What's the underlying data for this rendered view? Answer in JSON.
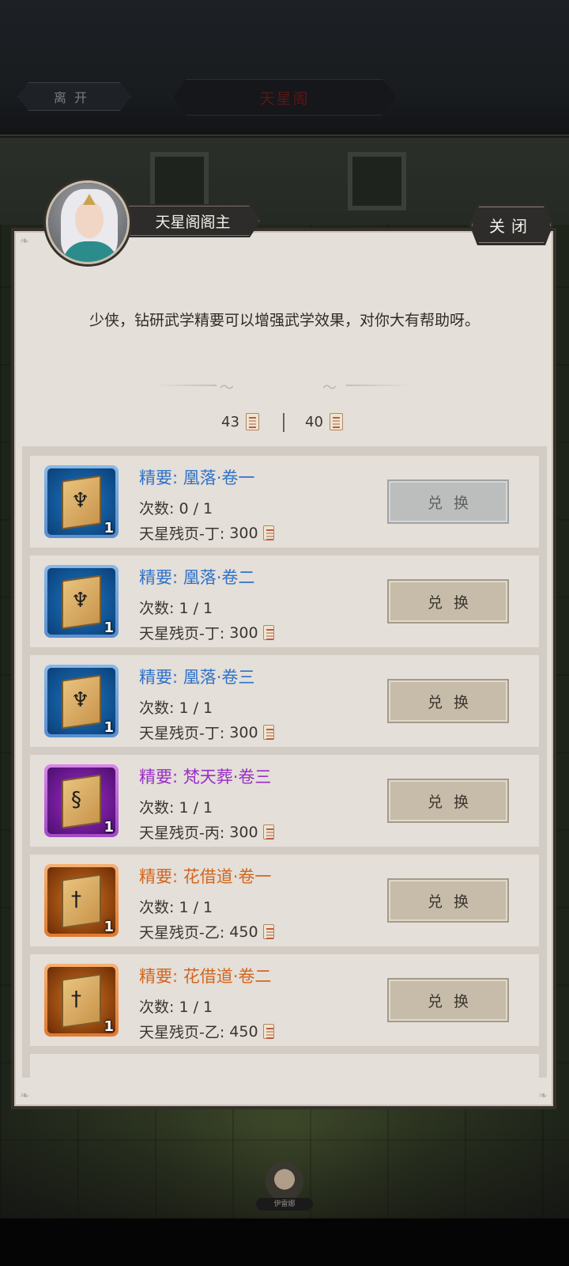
{
  "header": {
    "leave_label": "离开",
    "title": "天星阁"
  },
  "npc": {
    "name": "天星阁阁主",
    "dialog": "少侠，钻研武学精要可以增强武学效果，对你大有帮助呀。"
  },
  "close_label": "关闭",
  "currencies": [
    {
      "amount": "43",
      "icon": "scroll-page-icon"
    },
    {
      "amount": "40",
      "icon": "scroll-page-icon"
    }
  ],
  "items": [
    {
      "name": "精要: 凰落·卷一",
      "quality": "blue",
      "qty": "1",
      "count_label": "次数:",
      "count": "0 / 1",
      "cost_label": "天星残页-丁:",
      "cost": "300",
      "button": "兑换",
      "enabled": false
    },
    {
      "name": "精要: 凰落·卷二",
      "quality": "blue",
      "qty": "1",
      "count_label": "次数:",
      "count": "1 / 1",
      "cost_label": "天星残页-丁:",
      "cost": "300",
      "button": "兑换",
      "enabled": true
    },
    {
      "name": "精要: 凰落·卷三",
      "quality": "blue",
      "qty": "1",
      "count_label": "次数:",
      "count": "1 / 1",
      "cost_label": "天星残页-丁:",
      "cost": "300",
      "button": "兑换",
      "enabled": true
    },
    {
      "name": "精要: 梵天葬·卷三",
      "quality": "purple",
      "qty": "1",
      "count_label": "次数:",
      "count": "1 / 1",
      "cost_label": "天星残页-丙:",
      "cost": "300",
      "button": "兑换",
      "enabled": true
    },
    {
      "name": "精要: 花借道·卷一",
      "quality": "orange",
      "qty": "1",
      "count_label": "次数:",
      "count": "1 / 1",
      "cost_label": "天星残页-乙:",
      "cost": "450",
      "button": "兑换",
      "enabled": true
    },
    {
      "name": "精要: 花借道·卷二",
      "quality": "orange",
      "qty": "1",
      "count_label": "次数:",
      "count": "1 / 1",
      "cost_label": "天星残页-乙:",
      "cost": "450",
      "button": "兑换",
      "enabled": true
    }
  ],
  "bottom": {
    "npc_tag": "伊雷娜"
  },
  "colors": {
    "blue_quality": "#2f72c9",
    "purple_quality": "#9a2ec6",
    "orange_quality": "#d2661e"
  }
}
